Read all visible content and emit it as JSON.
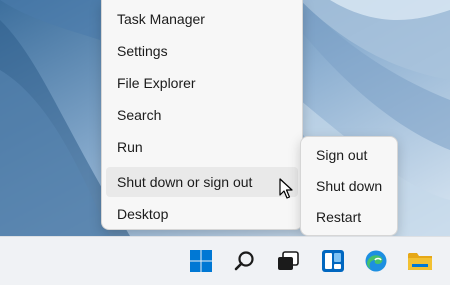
{
  "context_menu": {
    "items": [
      {
        "label": "Task Manager"
      },
      {
        "label": "Settings"
      },
      {
        "label": "File Explorer"
      },
      {
        "label": "Search"
      },
      {
        "label": "Run"
      },
      {
        "label": "Shut down or sign out",
        "has_submenu": true
      },
      {
        "label": "Desktop"
      }
    ]
  },
  "submenu": {
    "items": [
      {
        "label": "Sign out"
      },
      {
        "label": "Shut down"
      },
      {
        "label": "Restart"
      }
    ]
  },
  "taskbar": {
    "icons": [
      "windows-start-icon",
      "search-icon",
      "task-view-icon",
      "widgets-icon",
      "edge-browser-icon",
      "file-explorer-icon"
    ]
  },
  "colors": {
    "accent": "#0078d4",
    "menu_bg": "#f7f7f7",
    "hover_bg": "#e9e9e9",
    "folder": "#f2c132"
  }
}
